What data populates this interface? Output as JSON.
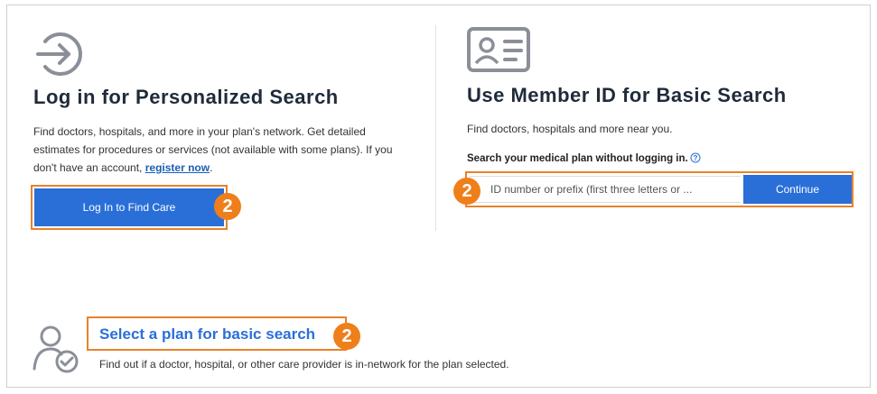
{
  "login_panel": {
    "title": "Log in for Personalized Search",
    "description_prefix": "Find doctors, hospitals, and more in your plan's network. Get detailed estimates for procedures or services (not available with some plans). If you don't have an account, ",
    "register_link": "register now",
    "description_suffix": ".",
    "button_label": "Log In to Find Care",
    "badge": "2",
    "icon": "arrow-right-circle-icon"
  },
  "member_id_panel": {
    "title": "Use Member ID for Basic Search",
    "description": "Find doctors, hospitals and more near you.",
    "search_label": "Search your medical plan without logging in.",
    "input_placeholder": "ID number or prefix (first three letters or ...",
    "input_value": "",
    "button_label": "Continue",
    "badge": "2",
    "icon": "id-card-icon"
  },
  "plan_panel": {
    "link_label": "Select a plan for basic search",
    "description": "Find out if a doctor, hospital, or other care provider is in-network for the plan selected.",
    "badge": "2",
    "icon": "user-check-icon"
  },
  "colors": {
    "accent_blue": "#2a6fd8",
    "highlight_orange": "#e8822a",
    "badge_orange": "#ef7f1a"
  }
}
